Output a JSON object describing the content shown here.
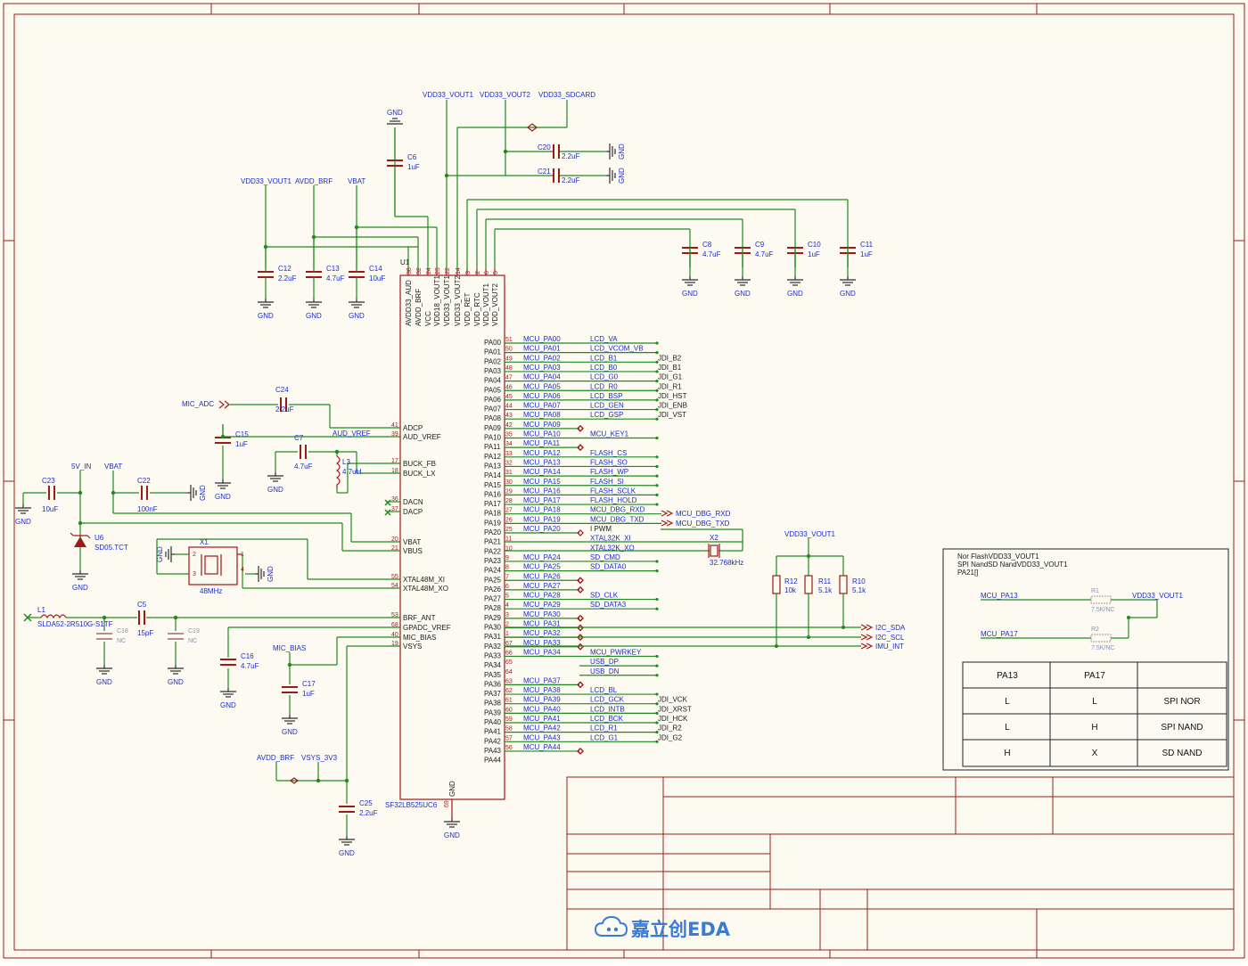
{
  "chip": {
    "ref": "U1",
    "part": "SF32LB525UC6",
    "top_pins": [
      {
        "num": "38",
        "name": "AVDD33_AUD"
      },
      {
        "num": "32",
        "name": "AVDD_BRF"
      },
      {
        "num": "24",
        "name": "VCC"
      },
      {
        "num": "23",
        "name": "VDD18_VOUT1"
      },
      {
        "num": "22",
        "name": "VDD33_VOUT1"
      },
      {
        "num": "14",
        "name": "VDD33_VOUT2"
      },
      {
        "num": "3",
        "name": "VDD_RET"
      },
      {
        "num": "2",
        "name": "VDD_RTC"
      },
      {
        "num": "6",
        "name": "VDD_VOUT1"
      },
      {
        "num": "5",
        "name": "VDD_VOUT2"
      }
    ],
    "left_pins": [
      {
        "num": "41",
        "name": "ADCP"
      },
      {
        "num": "39",
        "name": "AUD_VREF"
      },
      {
        "num": "17",
        "name": "BUCK_FB"
      },
      {
        "num": "18",
        "name": "BUCK_LX"
      },
      {
        "num": "36",
        "name": "DACN"
      },
      {
        "num": "37",
        "name": "DACP"
      },
      {
        "num": "20",
        "name": "VBAT"
      },
      {
        "num": "21",
        "name": "VBUS"
      },
      {
        "num": "55",
        "name": "XTAL48M_XI"
      },
      {
        "num": "54",
        "name": "XTAL48M_XO"
      },
      {
        "num": "53",
        "name": "BRF_ANT"
      },
      {
        "num": "68",
        "name": "GPADC_VREF"
      },
      {
        "num": "40",
        "name": "MIC_BIAS"
      },
      {
        "num": "19",
        "name": "VSYS"
      }
    ],
    "gnd_pin": {
      "num": "69",
      "name": "GND"
    },
    "right_pins": [
      {
        "pa": "PA00",
        "num": "51",
        "mcu": "MCU_PA00",
        "net": "LCD_VA",
        "jdi": ""
      },
      {
        "pa": "PA01",
        "num": "50",
        "mcu": "MCU_PA01",
        "net": "LCD_VCOM_VB",
        "jdi": ""
      },
      {
        "pa": "PA02",
        "num": "49",
        "mcu": "MCU_PA02",
        "net": "LCD_B1",
        "jdi": "JDI_B2"
      },
      {
        "pa": "PA03",
        "num": "48",
        "mcu": "MCU_PA03",
        "net": "LCD_B0",
        "jdi": "JDI_B1"
      },
      {
        "pa": "PA04",
        "num": "47",
        "mcu": "MCU_PA04",
        "net": "LCD_G0",
        "jdi": "JDI_G1"
      },
      {
        "pa": "PA05",
        "num": "46",
        "mcu": "MCU_PA05",
        "net": "LCD_R0",
        "jdi": "JDI_R1"
      },
      {
        "pa": "PA06",
        "num": "45",
        "mcu": "MCU_PA06",
        "net": "LCD_BSP",
        "jdi": "JDI_HST"
      },
      {
        "pa": "PA07",
        "num": "44",
        "mcu": "MCU_PA07",
        "net": "LCD_GEN",
        "jdi": "JDI_ENB"
      },
      {
        "pa": "PA08",
        "num": "43",
        "mcu": "MCU_PA08",
        "net": "LCD_GSP",
        "jdi": "JDI_VST"
      },
      {
        "pa": "PA09",
        "num": "42",
        "mcu": "MCU_PA09",
        "net": "",
        "jdi": ""
      },
      {
        "pa": "PA10",
        "num": "35",
        "mcu": "MCU_PA10",
        "net": "MCU_KEY1",
        "jdi": ""
      },
      {
        "pa": "PA11",
        "num": "34",
        "mcu": "MCU_PA11",
        "net": "",
        "jdi": ""
      },
      {
        "pa": "PA12",
        "num": "33",
        "mcu": "MCU_PA12",
        "net": "FLASH_CS",
        "jdi": ""
      },
      {
        "pa": "PA13",
        "num": "32",
        "mcu": "MCU_PA13",
        "net": "FLASH_SO",
        "jdi": ""
      },
      {
        "pa": "PA14",
        "num": "31",
        "mcu": "MCU_PA14",
        "net": "FLASH_WP",
        "jdi": ""
      },
      {
        "pa": "PA15",
        "num": "30",
        "mcu": "MCU_PA15",
        "net": "FLASH_SI",
        "jdi": ""
      },
      {
        "pa": "PA16",
        "num": "29",
        "mcu": "MCU_PA16",
        "net": "FLASH_SCLK",
        "jdi": ""
      },
      {
        "pa": "PA17",
        "num": "28",
        "mcu": "MCU_PA17",
        "net": "FLASH_HOLD",
        "jdi": ""
      },
      {
        "pa": "PA18",
        "num": "27",
        "mcu": "MCU_PA18",
        "net": "MCU_DBG_RXD",
        "jdi": ""
      },
      {
        "pa": "PA19",
        "num": "26",
        "mcu": "MCU_PA19",
        "net": "MCU_DBG_TXD",
        "jdi": ""
      },
      {
        "pa": "PA20",
        "num": "25",
        "mcu": "MCU_PA20",
        "net": "I PWM",
        "jdi": ""
      },
      {
        "pa": "PA21",
        "num": "11",
        "mcu": "",
        "net": "XTAL32K_XI",
        "jdi": ""
      },
      {
        "pa": "PA22",
        "num": "10",
        "mcu": "",
        "net": "XTAL32K_XO",
        "jdi": ""
      },
      {
        "pa": "PA23",
        "num": "9",
        "mcu": "MCU_PA24",
        "net": "SD_CMD",
        "jdi": ""
      },
      {
        "pa": "PA24",
        "num": "8",
        "mcu": "MCU_PA25",
        "net": "SD_DATA0",
        "jdi": ""
      },
      {
        "pa": "PA25",
        "num": "7",
        "mcu": "MCU_PA26",
        "net": "",
        "jdi": ""
      },
      {
        "pa": "PA26",
        "num": "6",
        "mcu": "MCU_PA27",
        "net": "",
        "jdi": ""
      },
      {
        "pa": "PA27",
        "num": "5",
        "mcu": "MCU_PA28",
        "net": "SD_CLK",
        "jdi": ""
      },
      {
        "pa": "PA28",
        "num": "4",
        "mcu": "MCU_PA29",
        "net": "SD_DATA3",
        "jdi": ""
      },
      {
        "pa": "PA29",
        "num": "3",
        "mcu": "MCU_PA30",
        "net": "",
        "jdi": ""
      },
      {
        "pa": "PA30",
        "num": "2",
        "mcu": "MCU_PA31",
        "net": "",
        "jdi": ""
      },
      {
        "pa": "PA31",
        "num": "1",
        "mcu": "MCU_PA32",
        "net": "",
        "jdi": ""
      },
      {
        "pa": "PA32",
        "num": "67",
        "mcu": "MCU_PA33",
        "net": "",
        "jdi": ""
      },
      {
        "pa": "PA33",
        "num": "66",
        "mcu": "MCU_PA34",
        "net": "MCU_PWRKEY",
        "jdi": ""
      },
      {
        "pa": "PA34",
        "num": "65",
        "mcu": "",
        "net": "USB_DP",
        "jdi": ""
      },
      {
        "pa": "PA35",
        "num": "64",
        "mcu": "",
        "net": "USB_DN",
        "jdi": ""
      },
      {
        "pa": "PA36",
        "num": "63",
        "mcu": "MCU_PA37",
        "net": "",
        "jdi": ""
      },
      {
        "pa": "PA37",
        "num": "62",
        "mcu": "MCU_PA38",
        "net": "LCD_BL",
        "jdi": ""
      },
      {
        "pa": "PA38",
        "num": "61",
        "mcu": "MCU_PA39",
        "net": "LCD_GCK",
        "jdi": "JDI_VCK"
      },
      {
        "pa": "PA39",
        "num": "60",
        "mcu": "MCU_PA40",
        "net": "LCD_INTB",
        "jdi": "JDI_XRST"
      },
      {
        "pa": "PA40",
        "num": "59",
        "mcu": "MCU_PA41",
        "net": "LCD_BCK",
        "jdi": "JDI_HCK"
      },
      {
        "pa": "PA41",
        "num": "58",
        "mcu": "MCU_PA42",
        "net": "LCD_R1",
        "jdi": "JDI_R2"
      },
      {
        "pa": "PA42",
        "num": "57",
        "mcu": "MCU_PA43",
        "net": "LCD_G1",
        "jdi": "JDI_G2"
      },
      {
        "pa": "PA43",
        "num": "56",
        "mcu": "MCU_PA44",
        "net": "",
        "jdi": ""
      },
      {
        "pa": "PA44",
        "num": "",
        "mcu": "",
        "net": "",
        "jdi": ""
      }
    ]
  },
  "power_nets": {
    "vdd33_vout1": "VDD33_VOUT1",
    "vdd33_vout2": "VDD33_VOUT2",
    "vdd33_sdcard": "VDD33_SDCARD",
    "avdd_brf": "AVDD_BRF",
    "vbat": "VBAT",
    "five_v_in": "5V_IN",
    "vsys_3v3": "VSYS_3V3",
    "mic_adc": "MIC_ADC",
    "mic_bias": "MIC_BIAS",
    "aud_vref": "AUD_VREF",
    "gnd": "GND",
    "dbg_rxd": "MCU_DBG_RXD",
    "dbg_txd": "MCU_DBG_TXD",
    "i2c_sda": "I2C_SDA",
    "i2c_scl": "I2C_SCL",
    "imu_int": "IMU_INT"
  },
  "components": {
    "C6": {
      "ref": "C6",
      "val": "1uF"
    },
    "C20": {
      "ref": "C20",
      "val": "2.2uF"
    },
    "C21": {
      "ref": "C21",
      "val": "2.2uF"
    },
    "C12": {
      "ref": "C12",
      "val": "2.2uF"
    },
    "C13": {
      "ref": "C13",
      "val": "4.7uF"
    },
    "C14": {
      "ref": "C14",
      "val": "10uF"
    },
    "C8": {
      "ref": "C8",
      "val": "4.7uF"
    },
    "C9": {
      "ref": "C9",
      "val": "4.7uF"
    },
    "C10": {
      "ref": "C10",
      "val": "1uF"
    },
    "C11": {
      "ref": "C11",
      "val": "1uF"
    },
    "C24": {
      "ref": "C24",
      "val": "2.2uF"
    },
    "C15": {
      "ref": "C15",
      "val": "1uF"
    },
    "C7": {
      "ref": "C7",
      "val": "4.7uF"
    },
    "L3": {
      "ref": "L3",
      "val": "4.7uH"
    },
    "C23": {
      "ref": "C23",
      "val": "10uF"
    },
    "C22": {
      "ref": "C22",
      "val": "100nF"
    },
    "U6": {
      "ref": "U6",
      "val": "SD05.TCT"
    },
    "X1": {
      "ref": "X1",
      "val": "48MHz"
    },
    "X2": {
      "ref": "X2",
      "val": "32.768kHz"
    },
    "L1": {
      "ref": "L1",
      "val": "SLDA52-2R510G-S1TF"
    },
    "C5": {
      "ref": "C5",
      "val": "15pF"
    },
    "C18": {
      "ref": "C18",
      "val": "NC"
    },
    "C19": {
      "ref": "C19",
      "val": "NC"
    },
    "C16": {
      "ref": "C16",
      "val": "4.7uF"
    },
    "C17": {
      "ref": "C17",
      "val": "1uF"
    },
    "C25": {
      "ref": "C25",
      "val": "2.2uF"
    },
    "R12": {
      "ref": "R12",
      "val": "10k"
    },
    "R11": {
      "ref": "R11",
      "val": "5.1k"
    },
    "R10": {
      "ref": "R10",
      "val": "5.1k"
    },
    "R1": {
      "ref": "R1",
      "val": "7.5K/NC"
    },
    "R2": {
      "ref": "R2",
      "val": "7.5K/NC"
    }
  },
  "boot_box": {
    "note_line1": "Nor FlashVDD33_VOUT1",
    "note_line2": "SPI NandSD NandVDD33_VOUT1",
    "note_line3": "PA21[]",
    "net_pa13": "MCU_PA13",
    "net_pa17": "MCU_PA17",
    "net_vdd": "VDD33_VOUT1",
    "table_headers": [
      "PA13",
      "PA17",
      ""
    ],
    "table_rows": [
      [
        "L",
        "L",
        "SPI NOR"
      ],
      [
        "L",
        "H",
        "SPI NAND"
      ],
      [
        "H",
        "X",
        "SD NAND"
      ]
    ]
  },
  "title_block": {
    "logo_text": "嘉立创EDA"
  },
  "colors": {
    "frame": "#9b1c1c",
    "wire": "#1f8a1f",
    "label": "#1a2bd0",
    "background": "#fdfbf1"
  }
}
